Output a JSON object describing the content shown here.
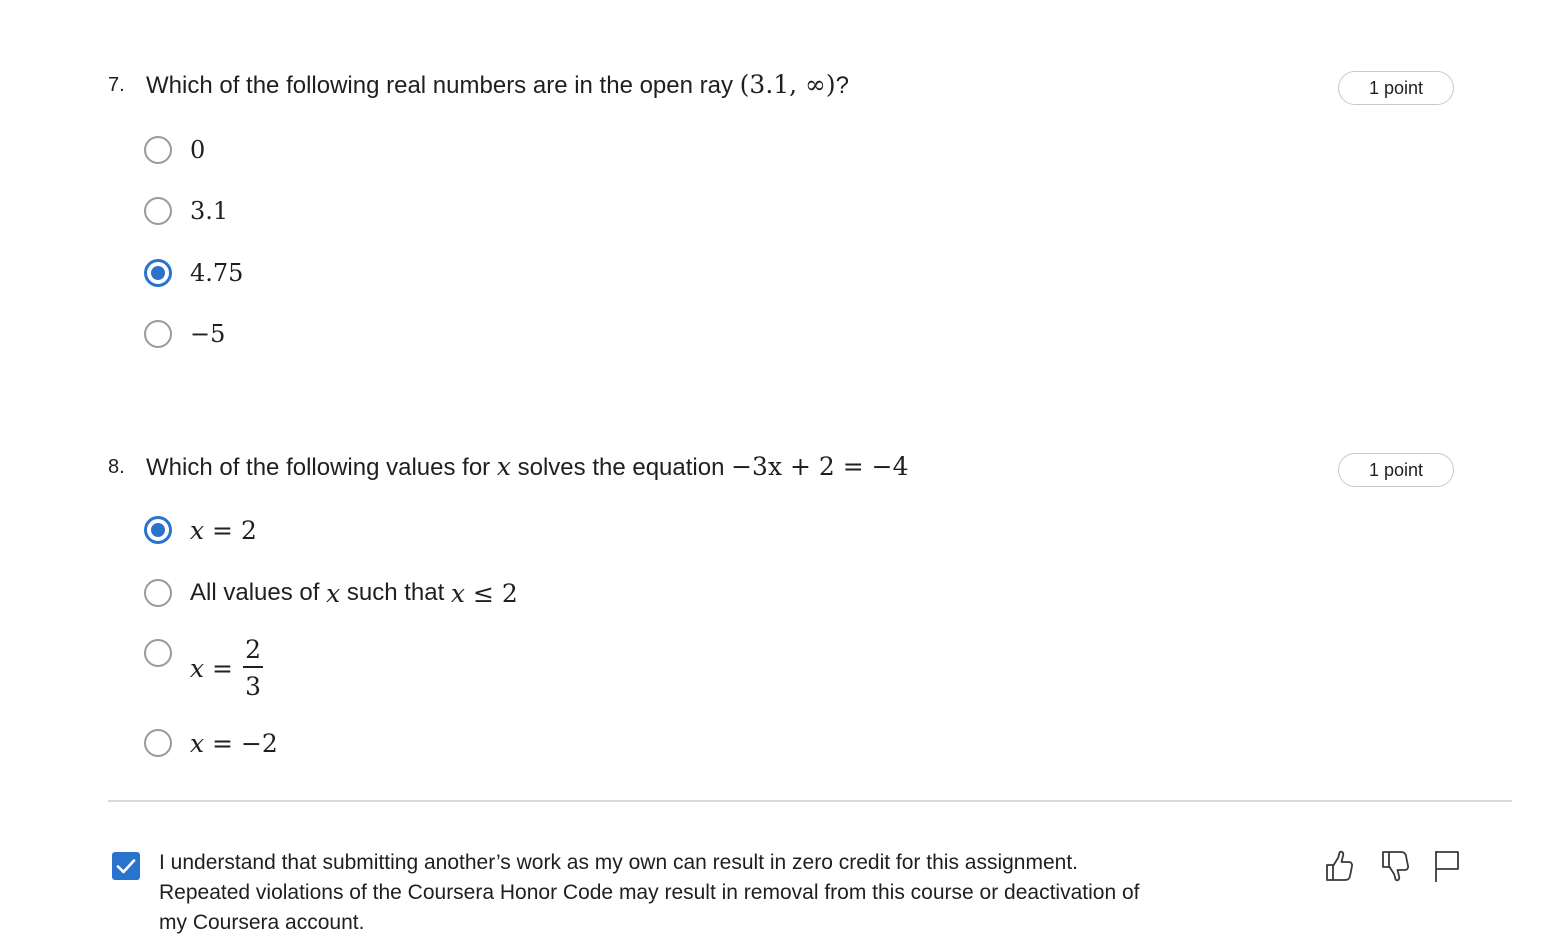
{
  "questions": [
    {
      "number": "7.",
      "text_prefix": "Which of the following real numbers are in the open ray ",
      "math": "(3.1, ∞)",
      "text_suffix": "?",
      "points": "1 point",
      "options": [
        {
          "label": "0",
          "selected": false
        },
        {
          "label": "3.1",
          "selected": false
        },
        {
          "label": "4.75",
          "selected": true
        },
        {
          "label": "−5",
          "selected": false
        }
      ]
    },
    {
      "number": "8.",
      "text_prefix": "Which of the following values for ",
      "var": "x",
      "text_middle": " solves the equation ",
      "equation": "−3x + 2 = −4",
      "points": "1 point",
      "options": [
        {
          "lhs": "x",
          "rhs": " = 2",
          "selected": true
        },
        {
          "text_a": "All values of ",
          "var_a": "x",
          "text_b": " such that ",
          "var_b": "x",
          "rhs": " ≤ 2",
          "selected": false
        },
        {
          "lhs": "x",
          "eq": " =",
          "numerator": "2",
          "denominator": "3",
          "selected": false
        },
        {
          "lhs": "x",
          "rhs": " = −2",
          "selected": false
        }
      ]
    }
  ],
  "honor_code": {
    "checked": true,
    "text": "I understand that submitting another’s work as my own can result in zero credit for this assignment. Repeated violations of the Coursera Honor Code may result in removal from this course or deactivation of my Coursera account."
  },
  "feedback_icons": [
    "thumbs-up-icon",
    "thumbs-down-icon",
    "flag-icon"
  ],
  "colors": {
    "accent": "#2a73cc",
    "radio_border": "#9a9a9a",
    "badge_border": "#c9c9c9",
    "divider": "#dadada",
    "text": "#1f1f1f"
  }
}
